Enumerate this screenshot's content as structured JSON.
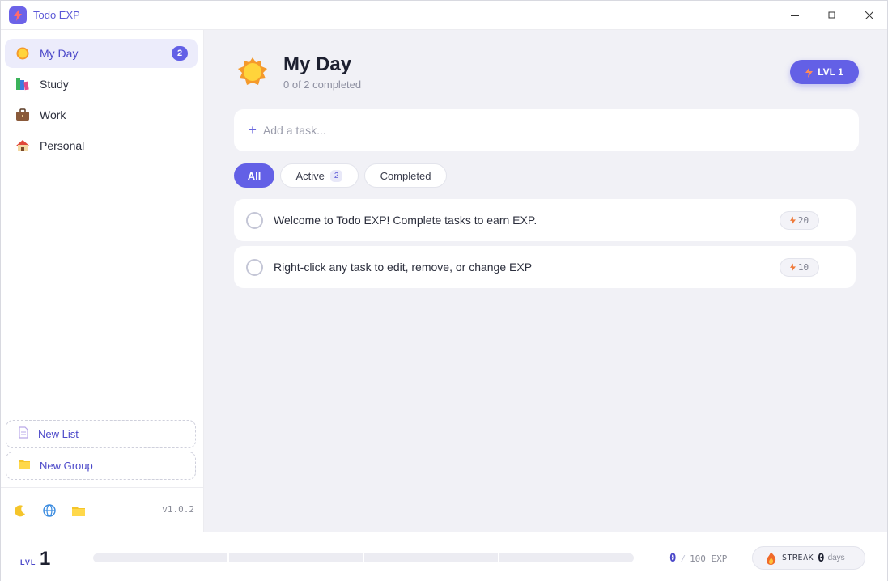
{
  "app": {
    "title": "Todo EXP"
  },
  "sidebar": {
    "items": [
      {
        "label": "My Day",
        "icon": "sun-icon",
        "count": "2",
        "active": true
      },
      {
        "label": "Study",
        "icon": "books-icon"
      },
      {
        "label": "Work",
        "icon": "briefcase-icon"
      },
      {
        "label": "Personal",
        "icon": "house-icon"
      }
    ],
    "new_list": "New List",
    "new_group": "New Group",
    "version": "v1.0.2"
  },
  "main": {
    "title": "My Day",
    "subtitle": "0 of 2 completed",
    "level_badge": "LVL 1",
    "add_placeholder": "Add a task...",
    "tabs": [
      {
        "label": "All",
        "active": true
      },
      {
        "label": "Active",
        "count": "2"
      },
      {
        "label": "Completed"
      }
    ],
    "tasks": [
      {
        "text": "Welcome to Todo EXP! Complete tasks to earn EXP.",
        "exp": "20"
      },
      {
        "text": "Right-click any task to edit, remove, or change EXP",
        "exp": "10"
      }
    ]
  },
  "footer": {
    "level_label": "LVL",
    "level": "1",
    "exp_current": "0",
    "exp_separator": "/",
    "exp_total": "100 EXP",
    "exp_progress": 0,
    "streak_label": "STREAK",
    "streak_days": "0",
    "streak_unit": "days"
  },
  "colors": {
    "accent": "#6360e6",
    "background": "#f1f1f6"
  }
}
